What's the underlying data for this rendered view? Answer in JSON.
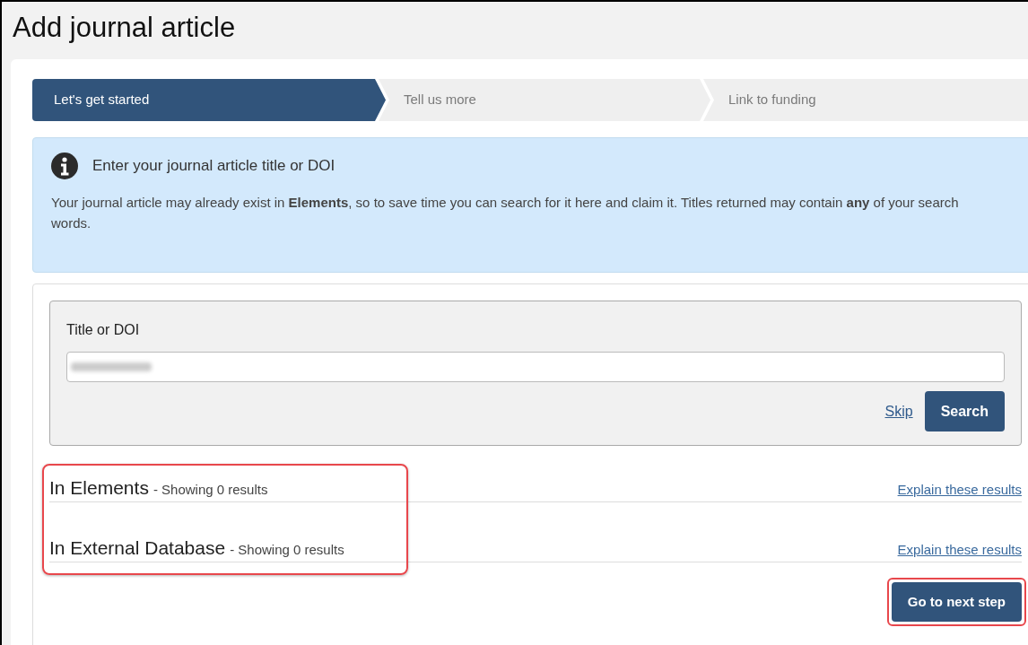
{
  "page": {
    "title": "Add journal article"
  },
  "steps": [
    {
      "label": "Let's get started",
      "selected": true
    },
    {
      "label": "Tell us more",
      "selected": false
    },
    {
      "label": "Link to funding",
      "selected": false
    }
  ],
  "info": {
    "heading": "Enter your journal article title or DOI",
    "text": "Your journal article may already exist in **Elements**, so to save time you can search for it here and claim it. Titles returned may contain **any** of your search words."
  },
  "search": {
    "label": "Title or DOI",
    "value_redacted": true,
    "skip_link": "Skip",
    "search_button": "Search"
  },
  "results": {
    "highlighted": true,
    "sections": [
      {
        "title": "In Elements",
        "summary": "- Showing 0 results",
        "link": "Explain these results"
      },
      {
        "title": "In External Database",
        "summary": "- Showing 0 results",
        "link": "Explain these results"
      }
    ]
  },
  "next_button": {
    "label": "Go to next step",
    "highlighted": true
  }
}
